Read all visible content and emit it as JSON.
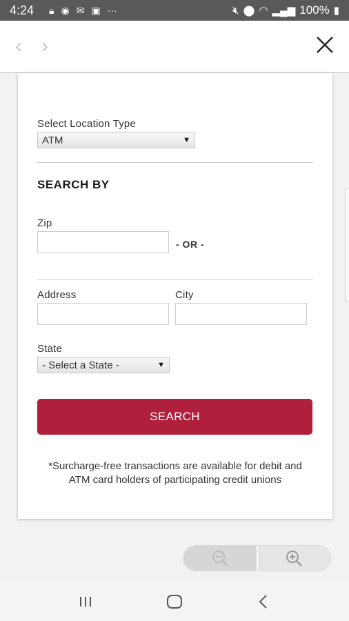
{
  "status_bar": {
    "time": "4:24",
    "left_icons": [
      "lock-icon",
      "account-icon",
      "mail-icon",
      "image-icon",
      "more-icon"
    ],
    "right_icons": [
      "mute-icon",
      "location-icon",
      "wifi-icon",
      "signal-icon",
      "battery-icon"
    ],
    "battery": "100%"
  },
  "toolbar": {
    "back_glyph": "‹",
    "forward_glyph": "›"
  },
  "form": {
    "location_type_label": "Select Location Type",
    "location_type_value": "ATM",
    "search_by_heading": "SEARCH BY",
    "zip_label": "Zip",
    "or_text": "- OR -",
    "address_label": "Address",
    "city_label": "City",
    "state_label": "State",
    "state_value": "- Select a State -",
    "search_button": "SEARCH",
    "note": "*Surcharge-free transactions are available for debit and ATM card holders of participating credit unions"
  },
  "colors": {
    "accent": "#b01f3c",
    "status_bar": "#595959"
  }
}
